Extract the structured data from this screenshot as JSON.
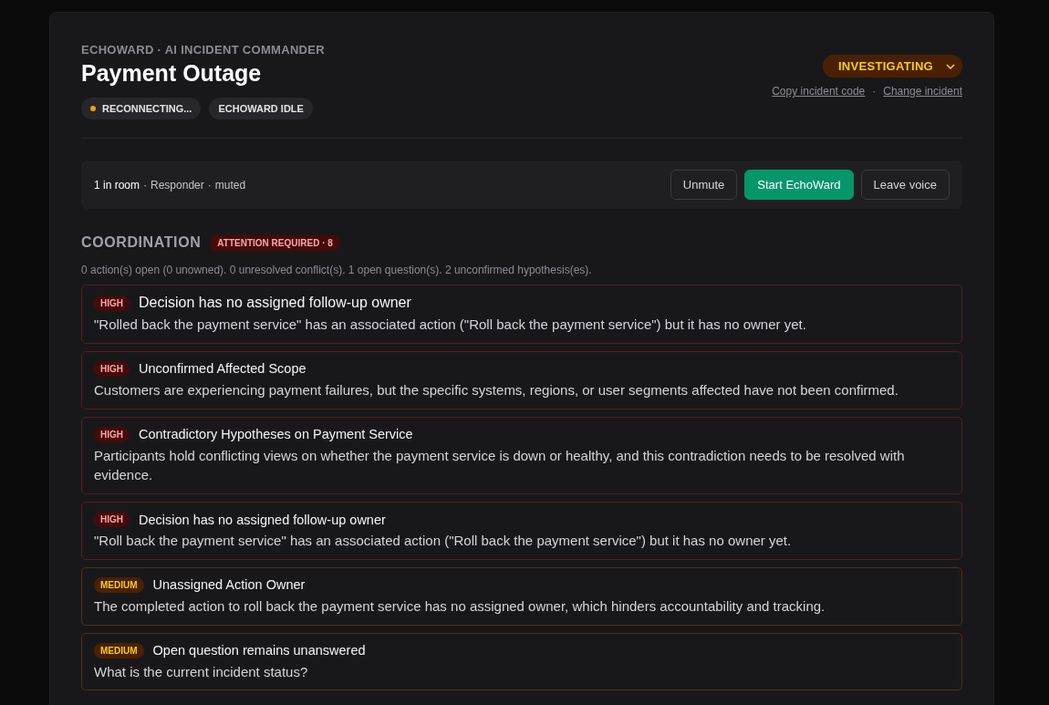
{
  "header": {
    "eyebrow": "ECHOWARD · AI INCIDENT COMMANDER",
    "title": "Payment Outage",
    "chips": [
      {
        "label": "RECONNECTING...",
        "kind": "status",
        "color": "#f59e0b"
      },
      {
        "label": "ECHOWARD IDLE",
        "kind": "plain"
      }
    ],
    "status_select": {
      "value": "INVESTIGATING"
    },
    "links": [
      "Copy incident code",
      "Change incident"
    ],
    "link_separator": "·"
  },
  "voice_bar": {
    "parts": [
      "1 in room",
      "Responder",
      "muted"
    ],
    "separator": "·",
    "buttons": [
      {
        "label": "Unmute",
        "kind": "secondary"
      },
      {
        "label": "Start EchoWard",
        "kind": "primary"
      },
      {
        "label": "Leave voice",
        "kind": "secondary"
      }
    ]
  },
  "coordination": {
    "heading": "COORDINATION",
    "badge": "ATTENTION REQUIRED · 8",
    "summary": "0 action(s) open (0 unowned). 0 unresolved conflict(s). 1 open question(s). 2 unconfirmed hypothesis(es).",
    "issues": [
      {
        "kind": "high",
        "label": "HIGH",
        "title": "Decision has no assigned follow-up owner",
        "detail": "\"Rolled back the payment service\" has an associated action (\"Roll back the payment service\") but it has no owner yet."
      },
      {
        "kind": "high",
        "label": "HIGH",
        "title": "Unconfirmed Affected Scope",
        "detail": "Customers are experiencing payment failures, but the specific systems, regions, or user segments affected have not been confirmed."
      },
      {
        "kind": "high",
        "label": "HIGH",
        "title": "Contradictory Hypotheses on Payment Service",
        "detail": "Participants hold conflicting views on whether the payment service is down or healthy, and this contradiction needs to be resolved with evidence."
      },
      {
        "kind": "high",
        "label": "HIGH",
        "title": "Decision has no assigned follow-up owner",
        "detail": "\"Roll back the payment service\" has an associated action (\"Roll back the payment service\") but it has no owner yet."
      },
      {
        "kind": "medium",
        "label": "MEDIUM",
        "title": "Unassigned Action Owner",
        "detail": "The completed action to roll back the payment service has no assigned owner, which hinders accountability and tracking."
      },
      {
        "kind": "medium",
        "label": "MEDIUM",
        "title": "Open question remains unanswered",
        "detail": "What is the current incident status?"
      }
    ]
  }
}
